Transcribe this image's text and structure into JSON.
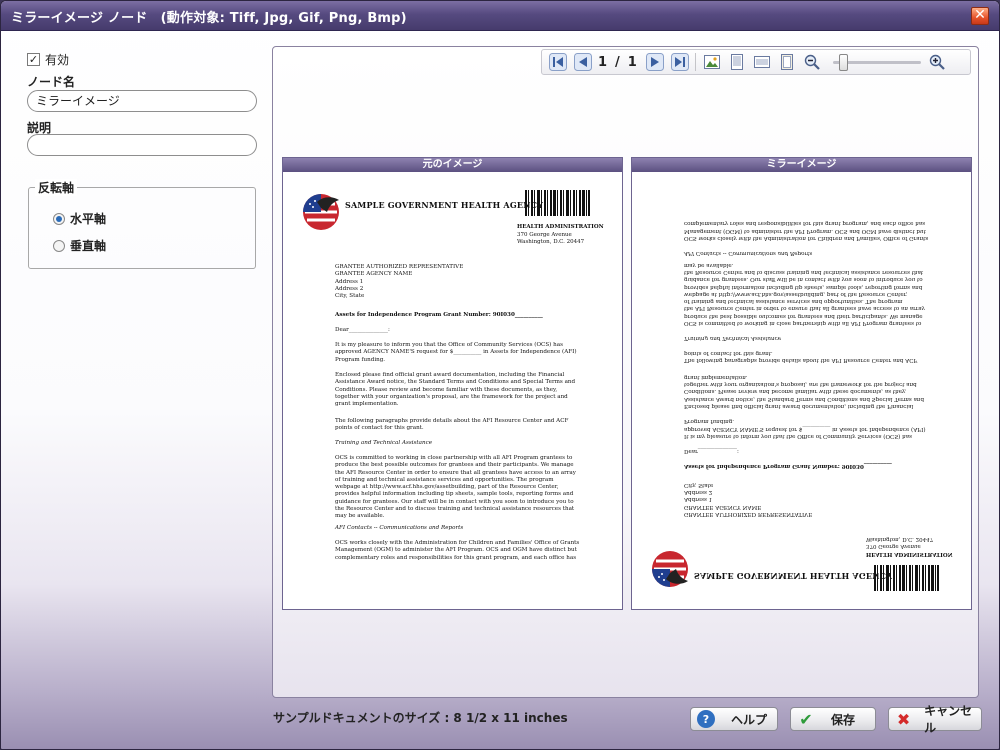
{
  "window": {
    "title": "ミラーイメージ ノード　(動作対象: Tiff, Jpg, Gif, Png, Bmp)",
    "close_icon": "close-icon"
  },
  "left": {
    "enabled_label": "有効",
    "enabled_checked": true,
    "node_name_label": "ノード名",
    "node_name_value": "ミラーイメージ",
    "description_label": "説明",
    "description_value": "",
    "axis_group_label": "反転軸",
    "horizontal_label": "水平軸",
    "vertical_label": "垂直軸",
    "selected_axis": "horizontal"
  },
  "toolbar": {
    "current_page": "1",
    "separator": "/",
    "total_pages": "1",
    "zoom_level": 0.1
  },
  "preview": {
    "original_title": "元のイメージ",
    "mirror_title": "ミラーイメージ",
    "document": {
      "agency": "SAMPLE GOVERNMENT HEALTH AGENCY",
      "admin": "HEALTH ADMINISTRATION",
      "street": "370 George Avenue",
      "city": "Washington, D.C. 20447",
      "recipient": [
        "GRANTEE AUTHORIZED REPRESENTATIVE",
        "GRANTEE AGENCY NAME",
        "Address 1",
        "Address 2",
        "City, State"
      ],
      "subject": "Assets for Independence Program Grant Number:  90I030__________",
      "salutation": "Dear______________:",
      "para1": "It is my pleasure to inform you that the Office of Community Services (OCS) has approved AGENCY NAME'S request for $__________ in Assets for Independence (AFI) Program funding.",
      "para2": "Enclosed please find official grant award documentation, including the Financial Assistance Award notice, the Standard Terms and Conditions and Special Terms and Conditions.  Please review and become familiar with these documents, as they, together with your organization's proposal, are the framework for the project and grant implementation.",
      "para3": "The following paragraphs provide details about the AFI Resource Center and ACF points of contact for this grant.",
      "heading1": "Training and Technical Assistance",
      "para4": "OCS is committed to working in close partnership with all AFI Program grantees to produce the best possible outcomes for grantees and their participants.  We manage the AFI Resource Center in order to ensure that all grantees have access to an array of training and technical assistance services and opportunities.   The program webpage at http://www.acf.hhs.gov/assetbuilding, part of the Resource Center, provides helpful information including tip sheets, sample tools, reporting forms and guidance for grantees. Our staff will be in contact with you soon to introduce you to the Resource Center and to discuss training and technical assistance resources that may be available.",
      "heading2": "AFI Contacts -- Communications and Reports",
      "para5": "OCS works closely with the Administration for Children and Families' Office of Grants Management (OGM) to administer the AFI Program.  OCS and OGM have distinct but complementary roles and responsibilities for this grant program, and each office has"
    }
  },
  "footer": {
    "sample_size": "サンプルドキュメントのサイズ : 8 1/2 x 11 inches",
    "help_label": "ヘルプ",
    "save_label": "保存",
    "cancel_label": "キャンセル",
    "help_icon_color": "#2f6fc0",
    "save_icon_color": "#2e9b3a",
    "cancel_icon_color": "#d42a2a"
  }
}
